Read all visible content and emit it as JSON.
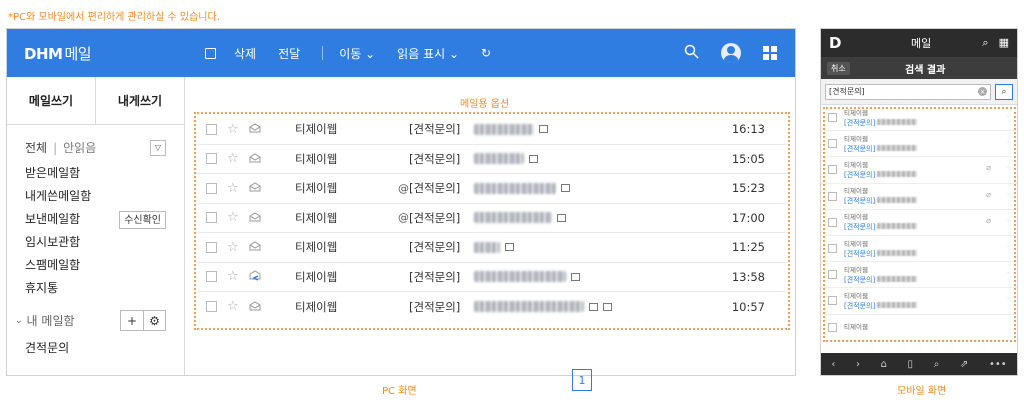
{
  "top_note": "*PC와 모바일에서 편리하게 관리하실 수 있습니다.",
  "pc": {
    "logo_main": "DHM",
    "logo_sub": "메일",
    "toolbar": {
      "delete": "삭제",
      "forward": "전달",
      "move": "이동",
      "read_mark": "읽음 표시"
    },
    "sidebar": {
      "compose": "메일쓰기",
      "self_compose": "내게쓰기",
      "filter_all": "전체",
      "filter_unread": "안읽음",
      "folders": [
        "받은메일함",
        "내게쓴메일함",
        "보낸메일함",
        "임시보관함",
        "스팸메일함",
        "휴지통"
      ],
      "recv_check": "수신확인",
      "my_mailbox": "내 메일함",
      "sub_folder": "견적문의"
    },
    "list_label": "메일용 옵션",
    "mails": [
      {
        "sender": "티제이웹",
        "tag": "[견적문의]",
        "clip": "",
        "time": "16:13"
      },
      {
        "sender": "티제이웹",
        "tag": "[견적문의]",
        "clip": "",
        "time": "15:05"
      },
      {
        "sender": "티제이웹",
        "tag": "[견적문의]",
        "clip": "@",
        "time": "15:23"
      },
      {
        "sender": "티제이웹",
        "tag": "[견적문의]",
        "clip": "@",
        "time": "17:00"
      },
      {
        "sender": "티제이웹",
        "tag": "[견적문의]",
        "clip": "",
        "time": "11:25"
      },
      {
        "sender": "티제이웹",
        "tag": "[견적문의]",
        "clip": "",
        "time": "13:58"
      },
      {
        "sender": "티제이웹",
        "tag": "[견적문의]",
        "clip": "",
        "time": "10:57"
      }
    ],
    "page": "1",
    "caption": "PC 화면"
  },
  "mobile": {
    "logo": "D",
    "title": "메일",
    "cancel": "취소",
    "sub_title": "검색 결과",
    "search_value": "[견적문의]",
    "rows": [
      {
        "sender": "티제이웹",
        "tag": "[견적문의]"
      },
      {
        "sender": "티제이웹",
        "tag": "[견적문의]"
      },
      {
        "sender": "티제이웹",
        "tag": "[견적문의]"
      },
      {
        "sender": "티제이웹",
        "tag": "[견적문의]"
      },
      {
        "sender": "티제이웹",
        "tag": "[견적문의]"
      },
      {
        "sender": "티제이웹",
        "tag": "[견적문의]"
      },
      {
        "sender": "티제이웹",
        "tag": "[견적문의]"
      },
      {
        "sender": "티제이웹",
        "tag": "[견적문의]"
      },
      {
        "sender": "티제이웹",
        "tag": ""
      }
    ],
    "caption": "모바일 화면"
  },
  "colors": {
    "brand": "#2f7de1",
    "accent": "#f08a24"
  }
}
